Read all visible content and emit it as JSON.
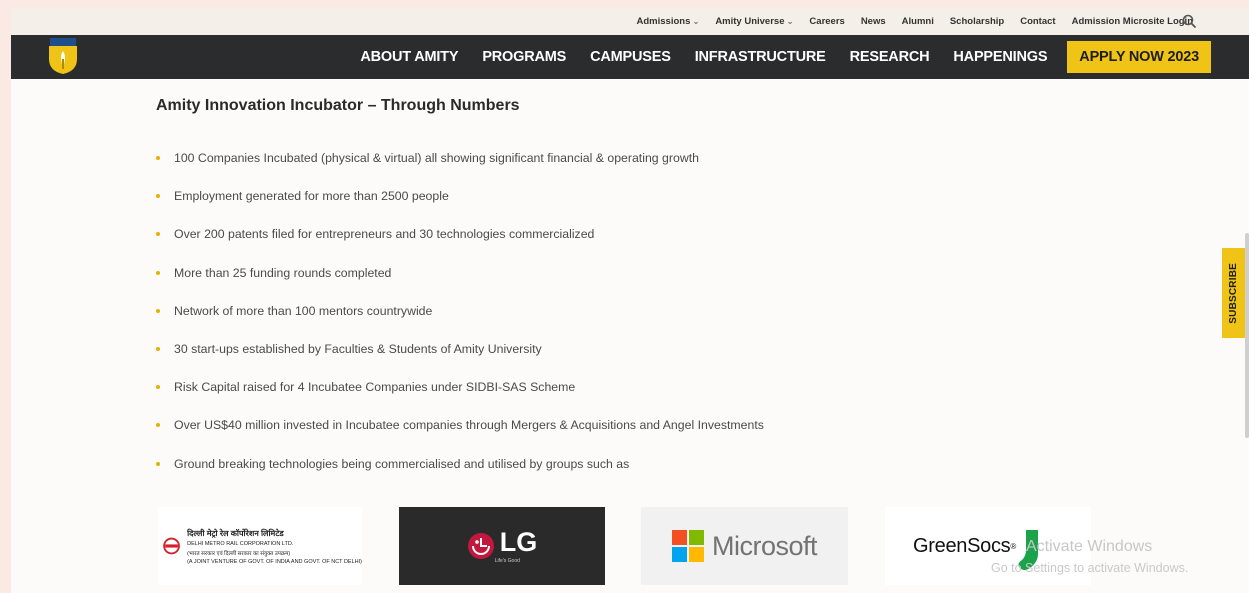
{
  "topbar": {
    "links": [
      {
        "label": "Admissions",
        "dropdown": true
      },
      {
        "label": "Amity Universe",
        "dropdown": true
      },
      {
        "label": "Careers",
        "dropdown": false
      },
      {
        "label": "News",
        "dropdown": false
      },
      {
        "label": "Alumni",
        "dropdown": false
      },
      {
        "label": "Scholarship",
        "dropdown": false
      },
      {
        "label": "Contact",
        "dropdown": false
      },
      {
        "label": "Admission Microsite Login",
        "dropdown": false
      }
    ],
    "search_icon": "search-icon"
  },
  "nav": {
    "items": [
      "ABOUT AMITY",
      "PROGRAMS",
      "CAMPUSES",
      "INFRASTRUCTURE",
      "RESEARCH",
      "HAPPENINGS"
    ],
    "apply_label": "APPLY NOW 2023",
    "logo_icon": "amity-logo-icon"
  },
  "content": {
    "heading": "Amity Innovation Incubator – Through Numbers",
    "bullets": [
      "100 Companies Incubated (physical & virtual) all showing significant financial & operating growth",
      "Employment generated for more than 2500 people",
      "Over 200 patents filed for entrepreneurs and 30 technologies commercialized",
      "More than 25 funding rounds completed",
      "Network of more than 100 mentors countrywide",
      "30 start-ups established by Faculties & Students of Amity University",
      "Risk Capital raised for 4 Incubatee Companies under SIDBI-SAS Scheme",
      "Over US$40 million invested in Incubatee companies through Mergers & Acquisitions and Angel Investments",
      "Ground breaking technologies being commercialised and utilised by groups such as"
    ]
  },
  "logos": {
    "dmrc_hindi": "दिल्ली मेट्रो रेल कॉर्पोरेशन लिमिटेड",
    "dmrc_english": "DELHI METRO RAIL CORPORATION LTD.",
    "dmrc_sub1": "(भारत सरकार एवं दिल्ली सरकार का संयुक्त उपक्रम)",
    "dmrc_sub2": "(A JOINT VENTURE OF GOVT. OF INDIA AND GOVT. OF NCT DELHI)",
    "lg_word": "LG",
    "lg_tagline": "Life's Good",
    "microsoft_word": "Microsoft",
    "greensocs_word": "GreenSocs",
    "greensocs_mark": "®"
  },
  "watermark": {
    "line1": "Activate Windows",
    "line2": "Go to Settings to activate Windows."
  },
  "subscribe_label": "SUBSCRIBE",
  "colors": {
    "accent_yellow": "#f0c417",
    "nav_bg": "#2b2c2e",
    "bullet": "#e6b200"
  }
}
